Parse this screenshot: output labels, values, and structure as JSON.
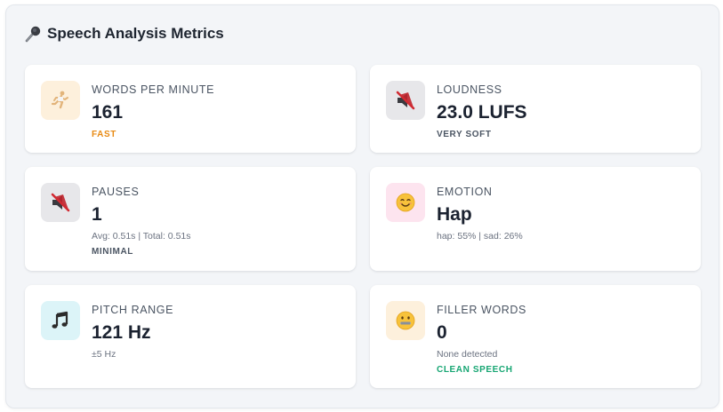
{
  "panel": {
    "title": "Speech Analysis Metrics",
    "title_icon": "microphone-icon"
  },
  "metrics": [
    {
      "label": "WORDS PER MINUTE",
      "value": "161",
      "status": "FAST",
      "status_color": "#e88a13",
      "icon": "runner-icon",
      "icon_bg": "#fdf0dc"
    },
    {
      "label": "LOUDNESS",
      "value": "23.0 LUFS",
      "status": "VERY SOFT",
      "status_color": "#4b5563",
      "icon": "muted-speaker-icon",
      "icon_bg": "#e7e7ea"
    },
    {
      "label": "PAUSES",
      "value": "1",
      "detail": "Avg: 0.51s | Total: 0.51s",
      "status": "MINIMAL",
      "status_color": "#4b5563",
      "icon": "muted-speaker-icon",
      "icon_bg": "#e7e7ea"
    },
    {
      "label": "EMOTION",
      "value": "Hap",
      "detail": "hap: 55% | sad: 26%",
      "icon": "smiling-face-icon",
      "icon_bg": "#fde4ef"
    },
    {
      "label": "PITCH RANGE",
      "value": "121 Hz",
      "detail": "±5 Hz",
      "icon": "music-note-icon",
      "icon_bg": "#dcf4f8"
    },
    {
      "label": "FILLER WORDS",
      "value": "0",
      "detail": "None detected",
      "status": "CLEAN SPEECH",
      "status_color": "#17a673",
      "icon": "zipper-mouth-face-icon",
      "icon_bg": "#fdf0dc"
    }
  ]
}
